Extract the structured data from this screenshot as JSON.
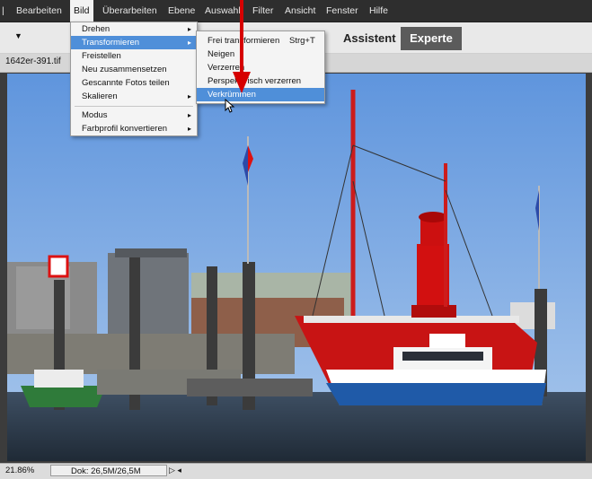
{
  "menubar": {
    "items": [
      {
        "label": "Bearbeiten"
      },
      {
        "label": "Bild"
      },
      {
        "label": "Überarbeiten"
      },
      {
        "label": "Ebene"
      },
      {
        "label": "Auswahl"
      },
      {
        "label": "Filter"
      },
      {
        "label": "Ansicht"
      },
      {
        "label": "Fenster"
      },
      {
        "label": "Hilfe"
      }
    ]
  },
  "modes": {
    "assistent": "Assistent",
    "experte": "Experte"
  },
  "file_tab": {
    "name": "1642er-391.tif"
  },
  "bild_menu": {
    "items": [
      {
        "label": "Drehen",
        "arrow": "▸"
      },
      {
        "label": "Transformieren",
        "arrow": "▸"
      },
      {
        "label": "Freistellen"
      },
      {
        "label": "Neu zusammensetzen"
      },
      {
        "label": "Gescannte Fotos teilen"
      },
      {
        "label": "Skalieren",
        "arrow": "▸"
      },
      {
        "label": "Modus",
        "arrow": "▸"
      },
      {
        "label": "Farbprofil konvertieren",
        "arrow": "▸"
      }
    ]
  },
  "transform_menu": {
    "items": [
      {
        "label": "Frei transformieren",
        "shortcut": "Strg+T"
      },
      {
        "label": "Neigen"
      },
      {
        "label": "Verzerren"
      },
      {
        "label": "Perspektivisch verzerren"
      },
      {
        "label": "Verkrümmen"
      }
    ]
  },
  "status": {
    "zoom": "21.86%",
    "doc": "Dok: 26,5M/26,5M",
    "nav": "▷ ◂"
  },
  "colors": {
    "accent": "#4f8fd9",
    "annotation": "#d60000"
  }
}
